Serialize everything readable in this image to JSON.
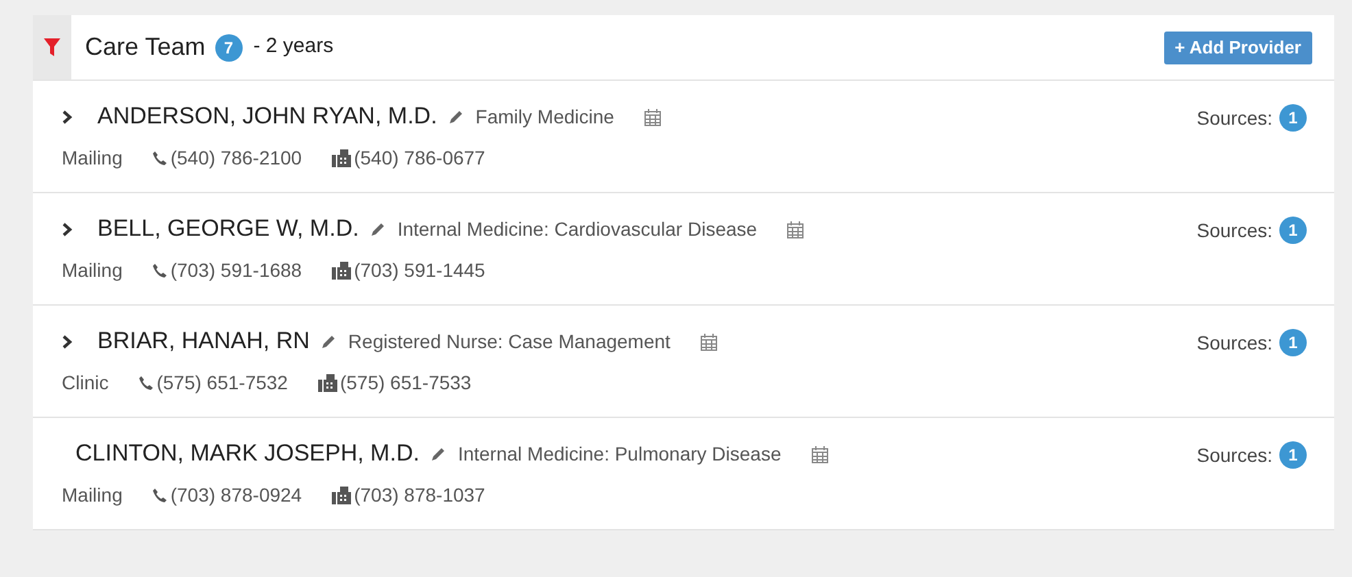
{
  "header": {
    "title": "Care Team",
    "count": "7",
    "period": "- 2 years",
    "add_button": "+ Add Provider"
  },
  "providers": [
    {
      "name": "ANDERSON, JOHN RYAN, M.D.",
      "expandable": true,
      "specialty": "Family Medicine",
      "address_type": "Mailing",
      "phone": "(540) 786-2100",
      "fax": "(540) 786-0677",
      "sources_label": "Sources:",
      "sources": "1"
    },
    {
      "name": "BELL, GEORGE W, M.D.",
      "expandable": true,
      "specialty": "Internal Medicine: Cardiovascular Disease",
      "address_type": "Mailing",
      "phone": "(703) 591-1688",
      "fax": "(703) 591-1445",
      "sources_label": "Sources:",
      "sources": "1"
    },
    {
      "name": "BRIAR, HANAH, RN",
      "expandable": true,
      "specialty": "Registered Nurse: Case Management",
      "address_type": "Clinic",
      "phone": "(575) 651-7532",
      "fax": "(575) 651-7533",
      "sources_label": "Sources:",
      "sources": "1"
    },
    {
      "name": "CLINTON, MARK JOSEPH, M.D.",
      "expandable": false,
      "specialty": "Internal Medicine: Pulmonary Disease",
      "address_type": "Mailing",
      "phone": "(703) 878-0924",
      "fax": "(703) 878-1037",
      "sources_label": "Sources:",
      "sources": "1"
    }
  ]
}
